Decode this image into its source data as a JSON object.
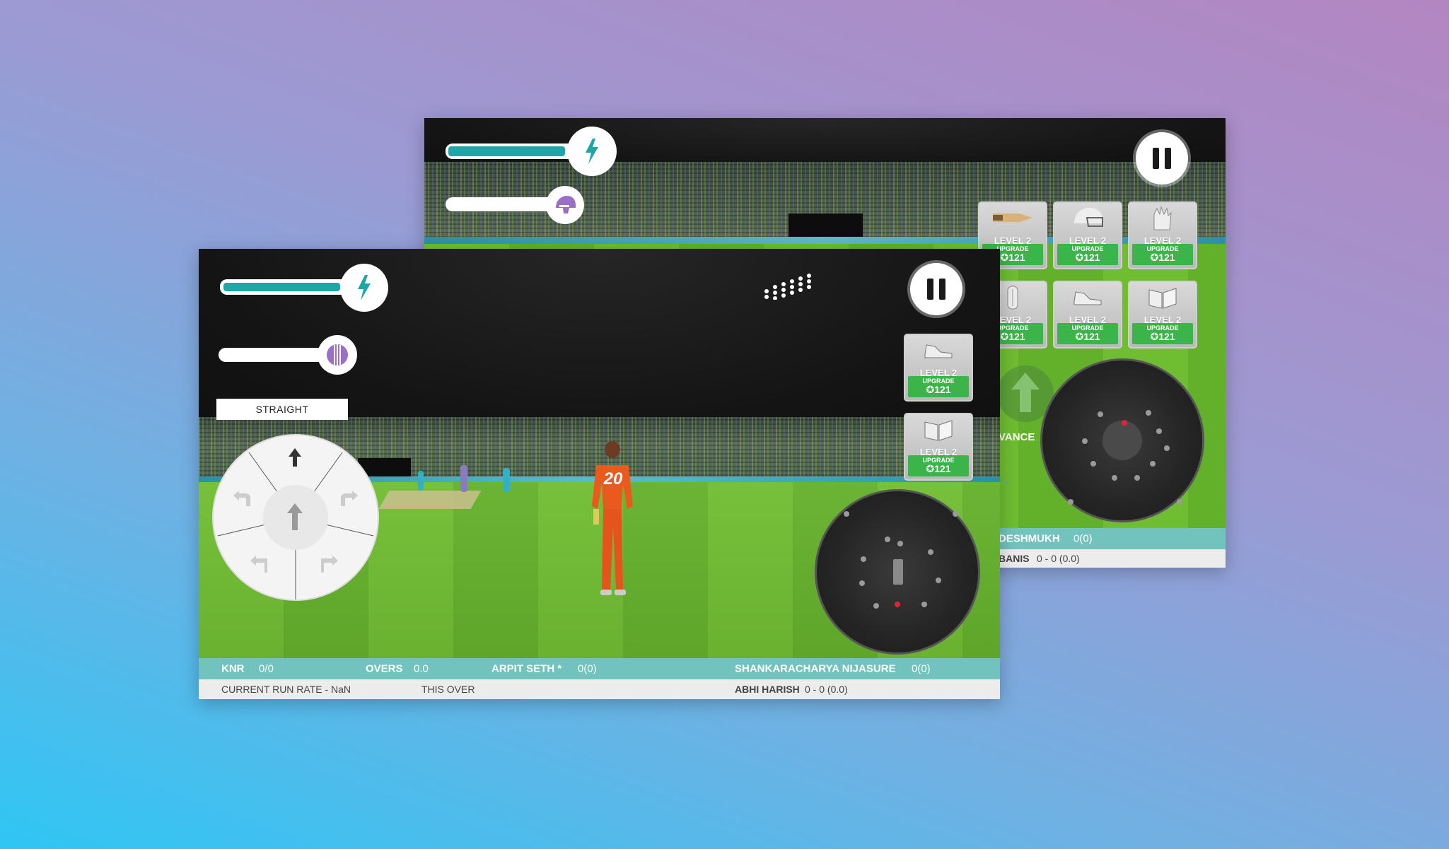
{
  "back_screen": {
    "upgrade_cards": [
      {
        "icon": "bat-icon",
        "level": "LEVEL 2",
        "upgrade": "UPGRADE",
        "cost": "121"
      },
      {
        "icon": "helmet-icon",
        "level": "LEVEL 2",
        "upgrade": "UPGRADE",
        "cost": "121"
      },
      {
        "icon": "gloves-icon",
        "level": "LEVEL 2",
        "upgrade": "UPGRADE",
        "cost": "121"
      },
      {
        "icon": "pads-icon",
        "level": "LEVEL 2",
        "upgrade": "UPGRADE",
        "cost": "121"
      },
      {
        "icon": "shoe-icon",
        "level": "LEVEL 2",
        "upgrade": "UPGRADE",
        "cost": "121"
      },
      {
        "icon": "book-icon",
        "level": "LEVEL 2",
        "upgrade": "UPGRADE",
        "cost": "121"
      }
    ],
    "advance_label": "VANCE",
    "score_bar": {
      "batsman": "DESHMUKH",
      "batsman_score": "0(0)"
    },
    "stats_bar": {
      "bowler": "BANIS",
      "bowler_figures": "0 - 0 (0.0)"
    }
  },
  "front_screen": {
    "direction_label": "STRAIGHT",
    "upgrade_cards": [
      {
        "icon": "shoe-icon",
        "level": "LEVEL 2",
        "upgrade": "UPGRADE",
        "cost": "121"
      },
      {
        "icon": "book-icon",
        "level": "LEVEL 2",
        "upgrade": "UPGRADE",
        "cost": "121"
      }
    ],
    "player_number": "20",
    "score_bar": {
      "team": "KNR",
      "team_score": "0/0",
      "overs_label": "OVERS",
      "overs_value": "0.0",
      "batsman1": "ARPIT SETH *",
      "batsman1_score": "0(0)",
      "batsman2": "SHANKARACHARYA NIJASURE",
      "batsman2_score": "0(0)"
    },
    "stats_bar": {
      "run_rate": "CURRENT RUN RATE - NaN",
      "this_over": "THIS OVER",
      "bowler": "ABHI HARISH",
      "bowler_figures": "0 - 0 (0.0)"
    }
  },
  "power_meter_fraction": 0.82,
  "colors": {
    "accent": "#1fa6a9",
    "score_bar": "#72c3bd",
    "upgrade_green": "#3bb54a",
    "ball_red": "#e32232",
    "helmet_purple": "#9b6fc8"
  }
}
